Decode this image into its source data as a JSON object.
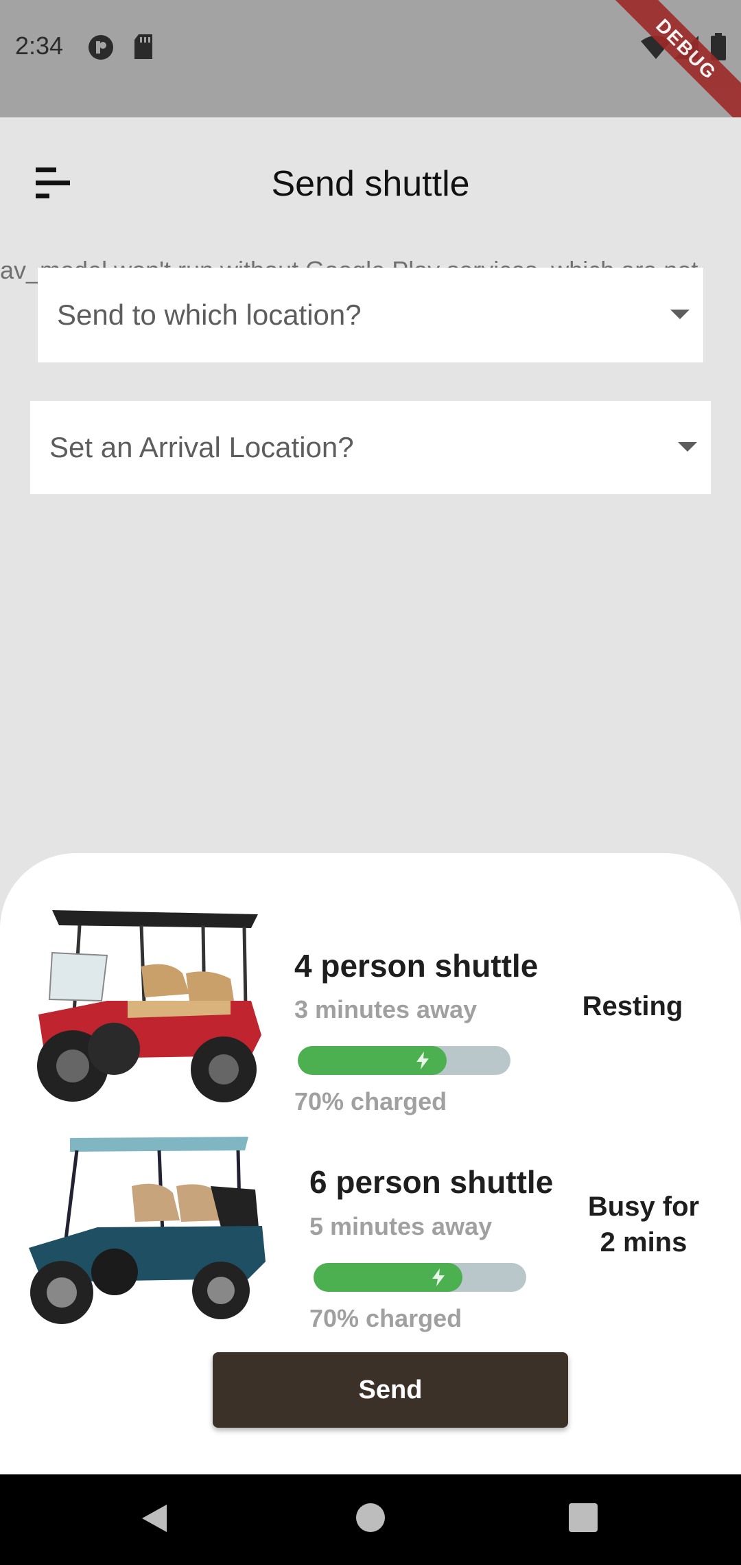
{
  "status_bar": {
    "time": "2:34",
    "debug_label": "DEBUG"
  },
  "app_bar": {
    "title": "Send shuttle",
    "menu_icon": "sort-menu-icon"
  },
  "background_warning": "av_model won't run without Google Play services, which are not",
  "form": {
    "send_location_placeholder": "Send to which location?",
    "arrival_location_placeholder": "Set an Arrival Location?"
  },
  "shuttles": [
    {
      "name": "4 person shuttle",
      "eta": "3 minutes away",
      "charge_percent": 70,
      "charge_label": "70% charged",
      "status": "Resting",
      "color": "#c0242e"
    },
    {
      "name": "6 person shuttle",
      "eta": "5 minutes away",
      "charge_percent": 70,
      "charge_label": "70% charged",
      "status": "Busy for\n2 mins",
      "color": "#1e4f63"
    }
  ],
  "actions": {
    "send_label": "Send"
  },
  "colors": {
    "accent_button": "#3b3129",
    "battery_fill": "#4caf50",
    "battery_track": "#b9c7cb"
  }
}
